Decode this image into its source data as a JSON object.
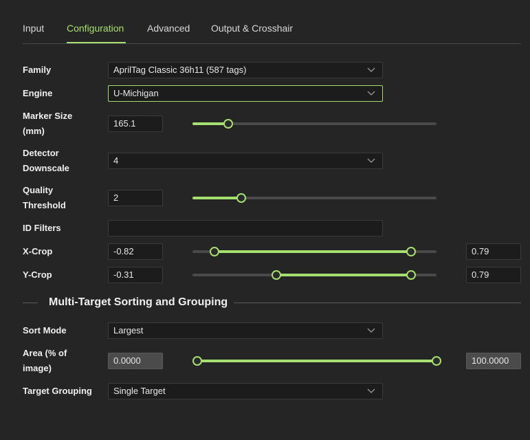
{
  "tabs": [
    {
      "label": "Input"
    },
    {
      "label": "Configuration"
    },
    {
      "label": "Advanced"
    },
    {
      "label": "Output & Crosshair"
    }
  ],
  "active_tab": "Configuration",
  "family": {
    "label": "Family",
    "value": "AprilTag Classic 36h11 (587 tags)"
  },
  "engine": {
    "label": "Engine",
    "value": "U-Michigan"
  },
  "marker_size": {
    "label_line1": "Marker Size",
    "label_line2": "(mm)",
    "value": "165.1",
    "slider_fraction": 0.147
  },
  "detector_downscale": {
    "label_line1": "Detector",
    "label_line2": "Downscale",
    "value": "4"
  },
  "quality_threshold": {
    "label_line1": "Quality",
    "label_line2": "Threshold",
    "value": "2",
    "slider_fraction": 0.2
  },
  "id_filters": {
    "label": "ID Filters",
    "value": ""
  },
  "x_crop": {
    "label": "X-Crop",
    "min": "-0.82",
    "max": "0.79",
    "range_fraction": [
      0.09,
      0.895
    ]
  },
  "y_crop": {
    "label": "Y-Crop",
    "min": "-0.31",
    "max": "0.79",
    "range_fraction": [
      0.345,
      0.895
    ]
  },
  "section": {
    "title": "Multi-Target Sorting and Grouping"
  },
  "sort_mode": {
    "label": "Sort Mode",
    "value": "Largest"
  },
  "area": {
    "label_line1": "Area (% of",
    "label_line2": "image)",
    "min": "0.0000",
    "max": "100.0000",
    "range_fraction": [
      0.0,
      1.0
    ]
  },
  "target_grouping": {
    "label": "Target Grouping",
    "value": "Single Target"
  },
  "colors": {
    "accent": "#a6e070",
    "background": "#252525",
    "field": "#1c1c1c"
  }
}
